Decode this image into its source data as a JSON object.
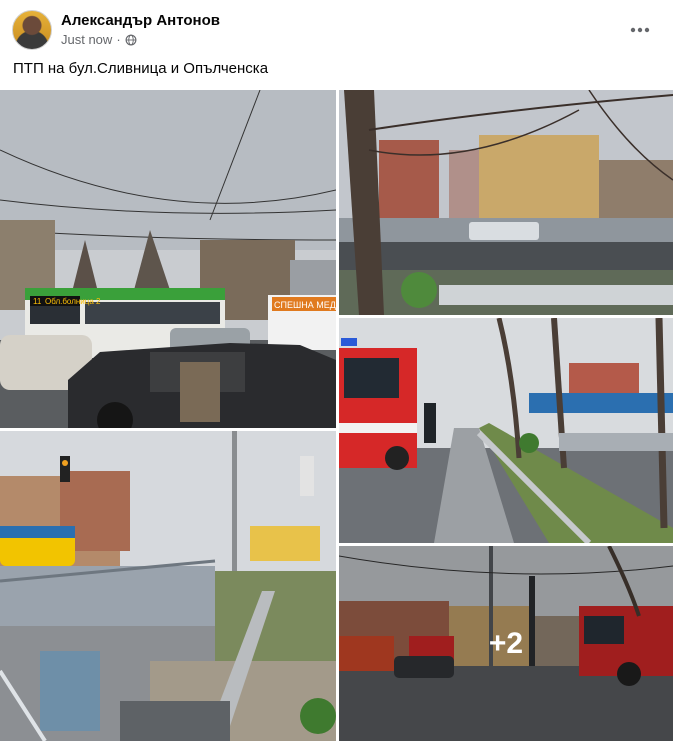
{
  "post": {
    "author": "Александър Антонов",
    "timestamp": "Just now",
    "privacy_icon": "globe-icon",
    "text": "ПТП на бул.Сливница и Опълченска"
  },
  "photos": {
    "bus_sign_line": "11",
    "bus_sign_dest": "Обл.болница 2",
    "ambulance_text": "СПЕШНА МЕДИЦ...",
    "more_count": "+2"
  },
  "colors": {
    "accent_text": "#65676b",
    "fire_truck": "#d62828"
  }
}
